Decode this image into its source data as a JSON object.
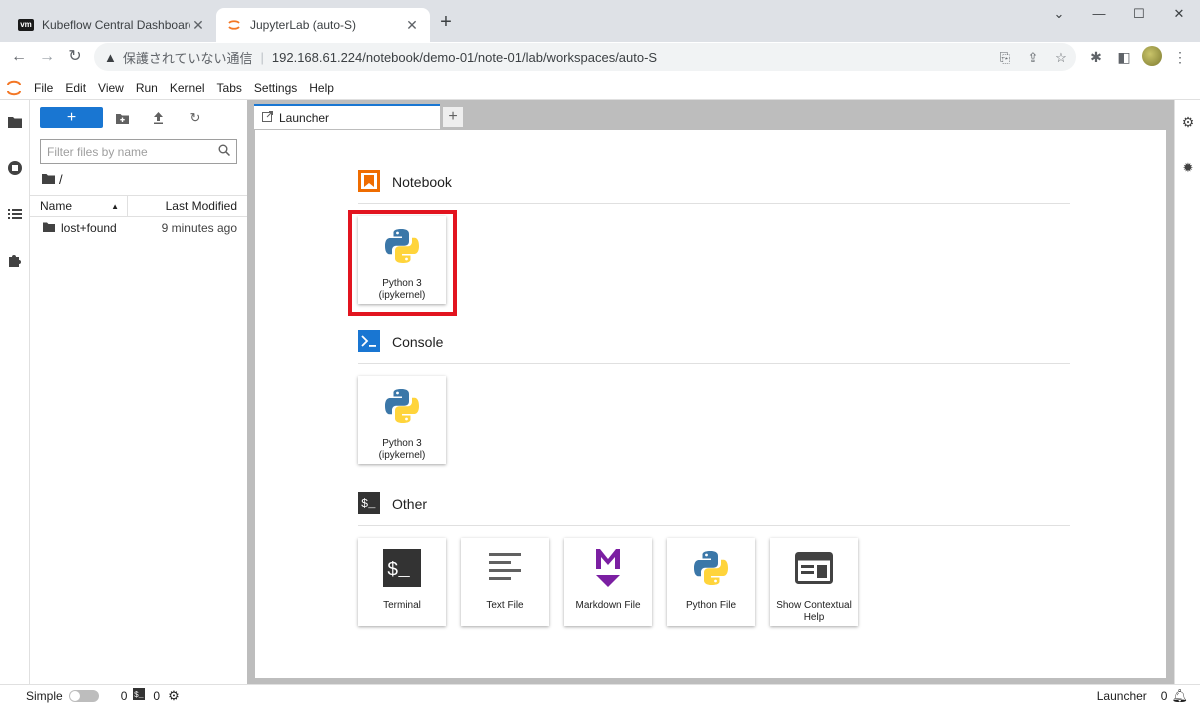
{
  "browser": {
    "tabs": [
      {
        "title": "Kubeflow Central Dashboard",
        "icon": "vm-icon",
        "icon_text": "vm"
      },
      {
        "title": "JupyterLab (auto-S)",
        "icon": "jupyter-icon"
      }
    ],
    "new_tab": "+",
    "security_warning": "保護されていない通信",
    "url": "192.168.61.224/notebook/demo-01/note-01/lab/workspaces/auto-S"
  },
  "menu": [
    "File",
    "Edit",
    "View",
    "Run",
    "Kernel",
    "Tabs",
    "Settings",
    "Help"
  ],
  "filebrowser": {
    "new_label": "+",
    "filter_placeholder": "Filter files by name",
    "breadcrumb": "/",
    "col_name": "Name",
    "col_modified": "Last Modified",
    "items": [
      {
        "name": "lost+found",
        "modified": "9 minutes ago",
        "type": "folder"
      }
    ]
  },
  "doc_tab": {
    "label": "Launcher",
    "add": "+"
  },
  "launcher": {
    "notebook": {
      "title": "Notebook",
      "cards": [
        {
          "label1": "Python 3",
          "label2": "(ipykernel)"
        }
      ]
    },
    "console": {
      "title": "Console",
      "cards": [
        {
          "label1": "Python 3",
          "label2": "(ipykernel)"
        }
      ]
    },
    "other": {
      "title": "Other",
      "cards": [
        {
          "label1": "Terminal",
          "label2": ""
        },
        {
          "label1": "Text File",
          "label2": ""
        },
        {
          "label1": "Markdown File",
          "label2": ""
        },
        {
          "label1": "Python File",
          "label2": ""
        },
        {
          "label1": "Show Contextual",
          "label2": "Help"
        }
      ]
    }
  },
  "statusbar": {
    "simple": "Simple",
    "terminals": "0",
    "kernels": "0",
    "mode": "Launcher",
    "notifications": "0"
  },
  "colors": {
    "accent": "#1976d2",
    "highlight": "#e2141f",
    "jupyter_orange": "#f37726"
  }
}
